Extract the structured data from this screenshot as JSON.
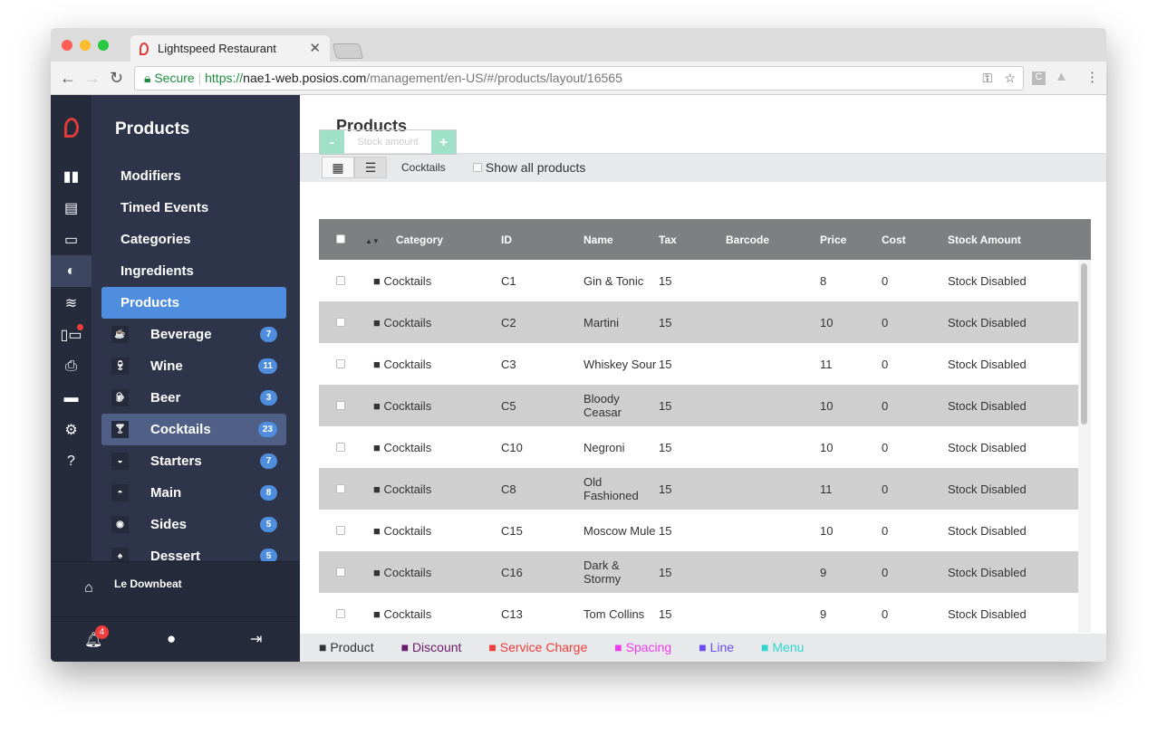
{
  "browser": {
    "tab_title": "Lightspeed Restaurant",
    "secure_label": "Secure",
    "url_proto": "https://",
    "url_host": "nae1-web.posios.com",
    "url_path": "/management/en-US/#/products/layout/16565"
  },
  "rail": [
    "chart-icon",
    "clipboard-icon",
    "id-card-icon",
    "dining-icon",
    "layers-icon",
    "devices-icon",
    "printer-icon",
    "card-icon",
    "gear-icon",
    "help-icon"
  ],
  "sidebar": {
    "title": "Products",
    "items": [
      "Modifiers",
      "Timed Events",
      "Categories",
      "Ingredients",
      "Products"
    ],
    "categories": [
      {
        "label": "Beverage",
        "count": "7"
      },
      {
        "label": "Wine",
        "count": "11"
      },
      {
        "label": "Beer",
        "count": "3"
      },
      {
        "label": "Cocktails",
        "count": "23"
      },
      {
        "label": "Starters",
        "count": "7"
      },
      {
        "label": "Main",
        "count": "8"
      },
      {
        "label": "Sides",
        "count": "5"
      },
      {
        "label": "Dessert",
        "count": "5"
      }
    ],
    "location": "Le Downbeat",
    "notifications": "4"
  },
  "main": {
    "title": "Products",
    "category": "Cocktails",
    "show_all": "Show all products",
    "stock_placeholder": "Stock amount",
    "minus": "-",
    "plus": "+"
  },
  "table": {
    "headers": [
      "Category",
      "ID",
      "Name",
      "Tax",
      "Barcode",
      "Price",
      "Cost",
      "Stock Amount"
    ],
    "rows": [
      [
        "■ Cocktails",
        "C1",
        "Gin & Tonic",
        "15",
        "",
        "8",
        "0",
        "Stock Disabled"
      ],
      [
        "■ Cocktails",
        "C2",
        "Martini",
        "15",
        "",
        "10",
        "0",
        "Stock Disabled"
      ],
      [
        "■ Cocktails",
        "C3",
        "Whiskey Sour",
        "15",
        "",
        "11",
        "0",
        "Stock Disabled"
      ],
      [
        "■ Cocktails",
        "C5",
        "Bloody Ceasar",
        "15",
        "",
        "10",
        "0",
        "Stock Disabled"
      ],
      [
        "■ Cocktails",
        "C10",
        "Negroni",
        "15",
        "",
        "10",
        "0",
        "Stock Disabled"
      ],
      [
        "■ Cocktails",
        "C8",
        "Old Fashioned",
        "15",
        "",
        "11",
        "0",
        "Stock Disabled"
      ],
      [
        "■ Cocktails",
        "C15",
        "Moscow Mule",
        "15",
        "",
        "10",
        "0",
        "Stock Disabled"
      ],
      [
        "■ Cocktails",
        "C16",
        "Dark & Stormy",
        "15",
        "",
        "9",
        "0",
        "Stock Disabled"
      ],
      [
        "■ Cocktails",
        "C13",
        "Tom Collins",
        "15",
        "",
        "9",
        "0",
        "Stock Disabled"
      ]
    ]
  },
  "legend": [
    {
      "label": "■ Product",
      "color": "#333333"
    },
    {
      "label": "■ Discount",
      "color": "#6a1a6a"
    },
    {
      "label": "■ Service Charge",
      "color": "#f23c3c"
    },
    {
      "label": "■ Spacing",
      "color": "#f03cf0"
    },
    {
      "label": "■ Line",
      "color": "#6a4cf5"
    },
    {
      "label": "■ Menu",
      "color": "#2fd6d0"
    }
  ]
}
